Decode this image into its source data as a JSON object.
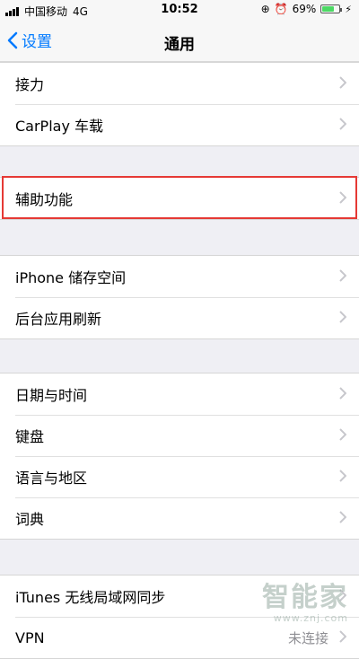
{
  "status_bar": {
    "carrier": "中国移动",
    "network": "4G",
    "time": "10:52",
    "battery": "69%",
    "battery_level": 0.69,
    "battery_color": "#4cd964"
  },
  "nav": {
    "back_label": "设置",
    "title": "通用",
    "accent_color": "#007aff"
  },
  "groups": [
    {
      "items": [
        "接力",
        "CarPlay 车载"
      ]
    },
    {
      "items": [
        "辅助功能"
      ],
      "highlighted": true,
      "highlight_color": "#e53935"
    },
    {
      "items": [
        "iPhone 储存空间",
        "后台应用刷新"
      ]
    },
    {
      "items": [
        "日期与时间",
        "键盘",
        "语言与地区",
        "词典"
      ]
    },
    {
      "items": [
        "iTunes 无线局域网同步",
        "VPN"
      ],
      "vpn_value": "未连接"
    }
  ],
  "watermark": {
    "main": "智能家",
    "url": "www.znj.com"
  },
  "icons": [
    "signal-icon",
    "lock-rotation-icon",
    "alarm-icon",
    "battery-icon",
    "charging-icon",
    "back-chevron-icon",
    "chevron-right-icon"
  ]
}
